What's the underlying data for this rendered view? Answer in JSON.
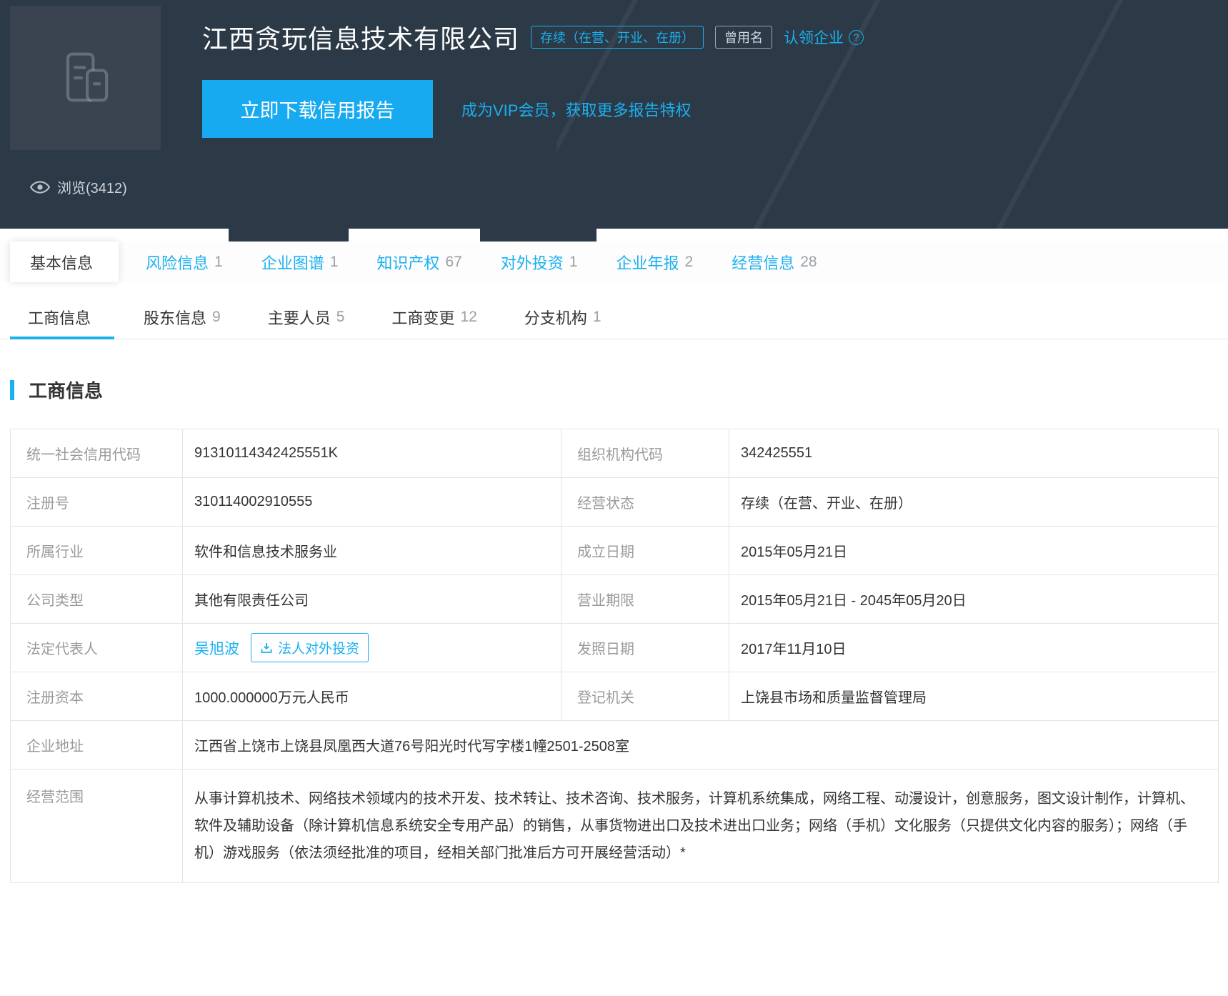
{
  "header": {
    "company_name": "江西贪玩信息技术有限公司",
    "status_badge": "存续（在营、开业、在册）",
    "former_name_badge": "曾用名",
    "claim_text": "认领企业",
    "claim_help_icon": "?",
    "download_button": "立即下载信用报告",
    "vip_text": "成为VIP会员，获取更多报告特权",
    "views_text": "浏览(3412)"
  },
  "tabs": [
    {
      "label": "基本信息",
      "count": ""
    },
    {
      "label": "风险信息",
      "count": "1"
    },
    {
      "label": "企业图谱",
      "count": "1"
    },
    {
      "label": "知识产权",
      "count": "67"
    },
    {
      "label": "对外投资",
      "count": "1"
    },
    {
      "label": "企业年报",
      "count": "2"
    },
    {
      "label": "经营信息",
      "count": "28"
    }
  ],
  "subtabs": [
    {
      "label": "工商信息",
      "count": ""
    },
    {
      "label": "股东信息",
      "count": "9"
    },
    {
      "label": "主要人员",
      "count": "5"
    },
    {
      "label": "工商变更",
      "count": "12"
    },
    {
      "label": "分支机构",
      "count": "1"
    }
  ],
  "section": {
    "title": "工商信息"
  },
  "table": {
    "rows": [
      {
        "l1": "统一社会信用代码",
        "v1": "91310114342425551K",
        "l2": "组织机构代码",
        "v2": "342425551"
      },
      {
        "l1": "注册号",
        "v1": "310114002910555",
        "l2": "经营状态",
        "v2": "存续（在营、开业、在册）"
      },
      {
        "l1": "所属行业",
        "v1": "软件和信息技术服务业",
        "l2": "成立日期",
        "v2": "2015年05月21日"
      },
      {
        "l1": "公司类型",
        "v1": "其他有限责任公司",
        "l2": "营业期限",
        "v2": "2015年05月21日 - 2045年05月20日"
      },
      {
        "l1": "法定代表人",
        "v1": "吴旭波",
        "v1_button": "法人对外投资",
        "l2": "发照日期",
        "v2": "2017年11月10日"
      },
      {
        "l1": "注册资本",
        "v1": "1000.000000万元人民币",
        "l2": "登记机关",
        "v2": "上饶县市场和质量监督管理局"
      }
    ],
    "full_rows": [
      {
        "label": "企业地址",
        "value": "江西省上饶市上饶县凤凰西大道76号阳光时代写字楼1幢2501-2508室"
      },
      {
        "label": "经营范围",
        "value": "从事计算机技术、网络技术领域内的技术开发、技术转让、技术咨询、技术服务，计算机系统集成，网络工程、动漫设计，创意服务，图文设计制作，计算机、软件及辅助设备（除计算机信息系统安全专用产品）的销售，从事货物进出口及技术进出口业务；网络（手机）文化服务（只提供文化内容的服务）；网络（手机）游戏服务（依法须经批准的项目，经相关部门批准后方可开展经营活动）*"
      }
    ]
  },
  "colors": {
    "accent": "#1ab1f0",
    "header_bg": "#2c3947",
    "download_button_bg": "#17aaf0"
  }
}
